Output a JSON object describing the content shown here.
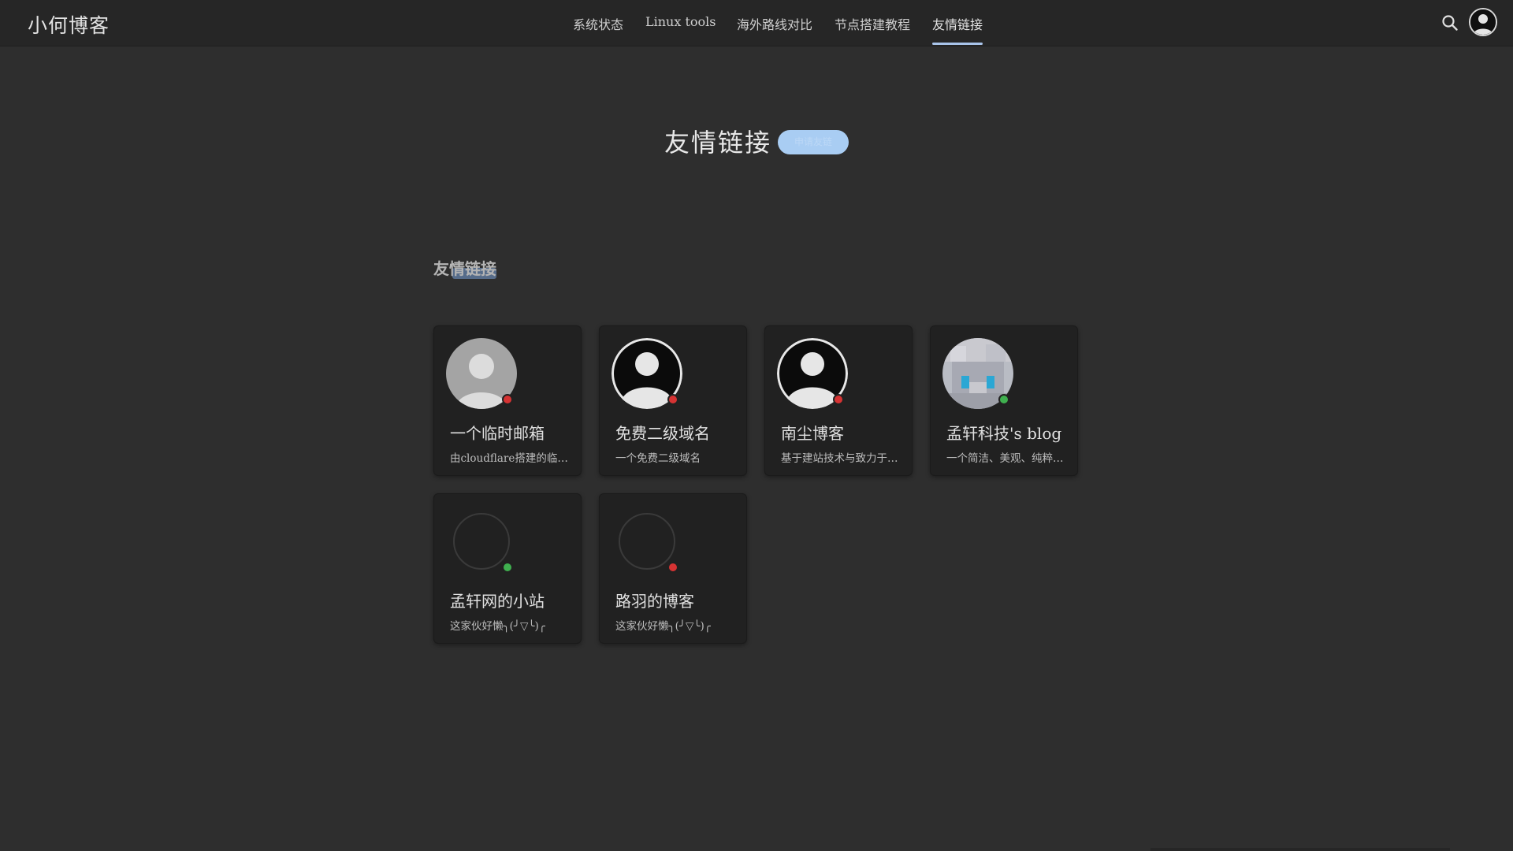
{
  "header": {
    "brand": "小何博客",
    "nav": [
      {
        "label": "系统状态"
      },
      {
        "label": "Linux tools"
      },
      {
        "label": "海外路线对比"
      },
      {
        "label": "节点搭建教程"
      },
      {
        "label": "友情链接",
        "active": true
      }
    ],
    "icons": {
      "search": "search-icon",
      "avatar": "user-avatar"
    }
  },
  "page": {
    "title": "友情链接",
    "badge": "申请友链"
  },
  "section": {
    "heading": "友情链接"
  },
  "links": [
    {
      "name": "一个临时邮箱",
      "desc": "由cloudflare搭建的临时邮箱",
      "status": "offline",
      "avatar": "default-gray"
    },
    {
      "name": "免费二级域名",
      "desc": "一个免费二级域名",
      "status": "offline",
      "avatar": "default-black"
    },
    {
      "name": "南尘博客",
      "desc": "基于建站技术与致力于分享",
      "status": "offline",
      "avatar": "default-black"
    },
    {
      "name": "孟轩科技's blog",
      "desc": "一个简洁、美观、纯粹的博客",
      "status": "online",
      "avatar": "anime-pixel"
    },
    {
      "name": "孟轩网的小站",
      "desc": "这家伙好懒╮(╯▽╰)╭",
      "status": "online",
      "avatar": "empty"
    },
    {
      "name": "路羽的博客",
      "desc": "这家伙好懒╮(╯▽╰)╭",
      "status": "offline",
      "avatar": "empty"
    }
  ],
  "colors": {
    "background": "#2e2e2e",
    "header": "#262626",
    "card": "#212121",
    "accent": "#a9c4ea",
    "online": "#3fb04f",
    "offline": "#d63333"
  }
}
